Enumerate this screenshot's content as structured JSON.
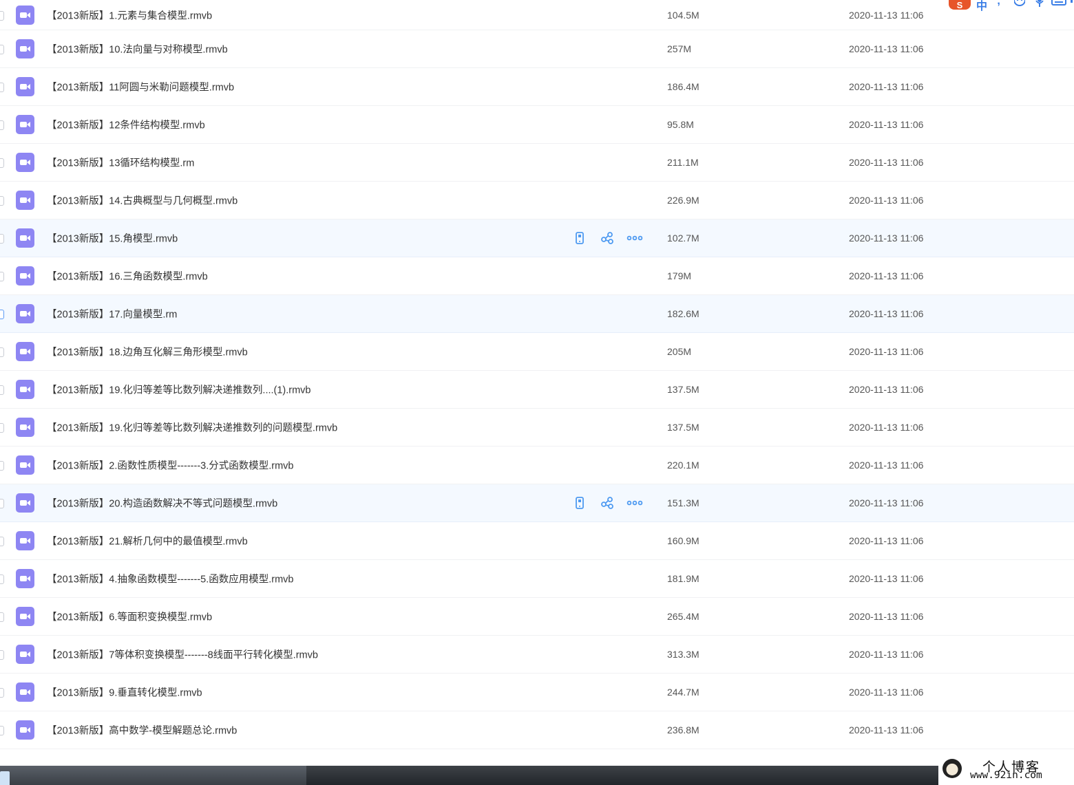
{
  "colors": {
    "file_icon": "#8e86f3",
    "action_icon": "#4e9af1",
    "row_highlight": "#f4f9ff"
  },
  "files": [
    {
      "name": "【2013新版】1.元素与集合模型.rmvb",
      "size": "104.5M",
      "date": "2020-11-13 11:06",
      "icon": "video-file-icon"
    },
    {
      "name": "【2013新版】10.法向量与对称模型.rmvb",
      "size": "257M",
      "date": "2020-11-13 11:06",
      "icon": "video-file-icon"
    },
    {
      "name": "【2013新版】11阿圆与米勒问题模型.rmvb",
      "size": "186.4M",
      "date": "2020-11-13 11:06",
      "icon": "video-file-icon"
    },
    {
      "name": "【2013新版】12条件结构模型.rmvb",
      "size": "95.8M",
      "date": "2020-11-13 11:06",
      "icon": "video-file-icon"
    },
    {
      "name": "【2013新版】13循环结构模型.rm",
      "size": "211.1M",
      "date": "2020-11-13 11:06",
      "icon": "video-file-icon"
    },
    {
      "name": "【2013新版】14.古典概型与几何概型.rmvb",
      "size": "226.9M",
      "date": "2020-11-13 11:06",
      "icon": "video-file-icon"
    },
    {
      "name": "【2013新版】15.角模型.rmvb",
      "size": "102.7M",
      "date": "2020-11-13 11:06",
      "icon": "video-file-icon",
      "highlight": true,
      "show_actions": true
    },
    {
      "name": "【2013新版】16.三角函数模型.rmvb",
      "size": "179M",
      "date": "2020-11-13 11:06",
      "icon": "video-file-icon"
    },
    {
      "name": "【2013新版】17.向量模型.rm",
      "size": "182.6M",
      "date": "2020-11-13 11:06",
      "icon": "video-file-icon",
      "highlight": true,
      "selected": true
    },
    {
      "name": "【2013新版】18.边角互化解三角形模型.rmvb",
      "size": "205M",
      "date": "2020-11-13 11:06",
      "icon": "video-file-icon"
    },
    {
      "name": "【2013新版】19.化归等差等比数列解决递推数列....(1).rmvb",
      "size": "137.5M",
      "date": "2020-11-13 11:06",
      "icon": "video-file-icon"
    },
    {
      "name": "【2013新版】19.化归等差等比数列解决递推数列的问题模型.rmvb",
      "size": "137.5M",
      "date": "2020-11-13 11:06",
      "icon": "video-file-icon"
    },
    {
      "name": "【2013新版】2.函数性质模型-------3.分式函数模型.rmvb",
      "size": "220.1M",
      "date": "2020-11-13 11:06",
      "icon": "video-file-icon"
    },
    {
      "name": "【2013新版】20.构造函数解决不等式问题模型.rmvb",
      "size": "151.3M",
      "date": "2020-11-13 11:06",
      "icon": "video-file-icon",
      "highlight": true,
      "show_actions": true
    },
    {
      "name": "【2013新版】21.解析几何中的最值模型.rmvb",
      "size": "160.9M",
      "date": "2020-11-13 11:06",
      "icon": "video-file-icon"
    },
    {
      "name": "【2013新版】4.抽象函数模型-------5.函数应用模型.rmvb",
      "size": "181.9M",
      "date": "2020-11-13 11:06",
      "icon": "video-file-icon"
    },
    {
      "name": "【2013新版】6.等面积变换模型.rmvb",
      "size": "265.4M",
      "date": "2020-11-13 11:06",
      "icon": "video-file-icon"
    },
    {
      "name": "【2013新版】7等体积变换模型-------8线面平行转化模型.rmvb",
      "size": "313.3M",
      "date": "2020-11-13 11:06",
      "icon": "video-file-icon"
    },
    {
      "name": "【2013新版】9.垂直转化模型.rmvb",
      "size": "244.7M",
      "date": "2020-11-13 11:06",
      "icon": "video-file-icon"
    },
    {
      "name": "【2013新版】高中数学-模型解题总论.rmvb",
      "size": "236.8M",
      "date": "2020-11-13 11:06",
      "icon": "video-file-icon"
    }
  ],
  "row_actions": [
    "phone-icon",
    "share-icon",
    "more-icon"
  ],
  "ime_toolbar": {
    "logo": "S",
    "language": "中",
    "punctuation": "°,",
    "icons": [
      "emoji-icon",
      "microphone-icon",
      "keyboard-icon"
    ]
  },
  "watermark": {
    "title": "个人博客",
    "url": "www.92in.com"
  }
}
